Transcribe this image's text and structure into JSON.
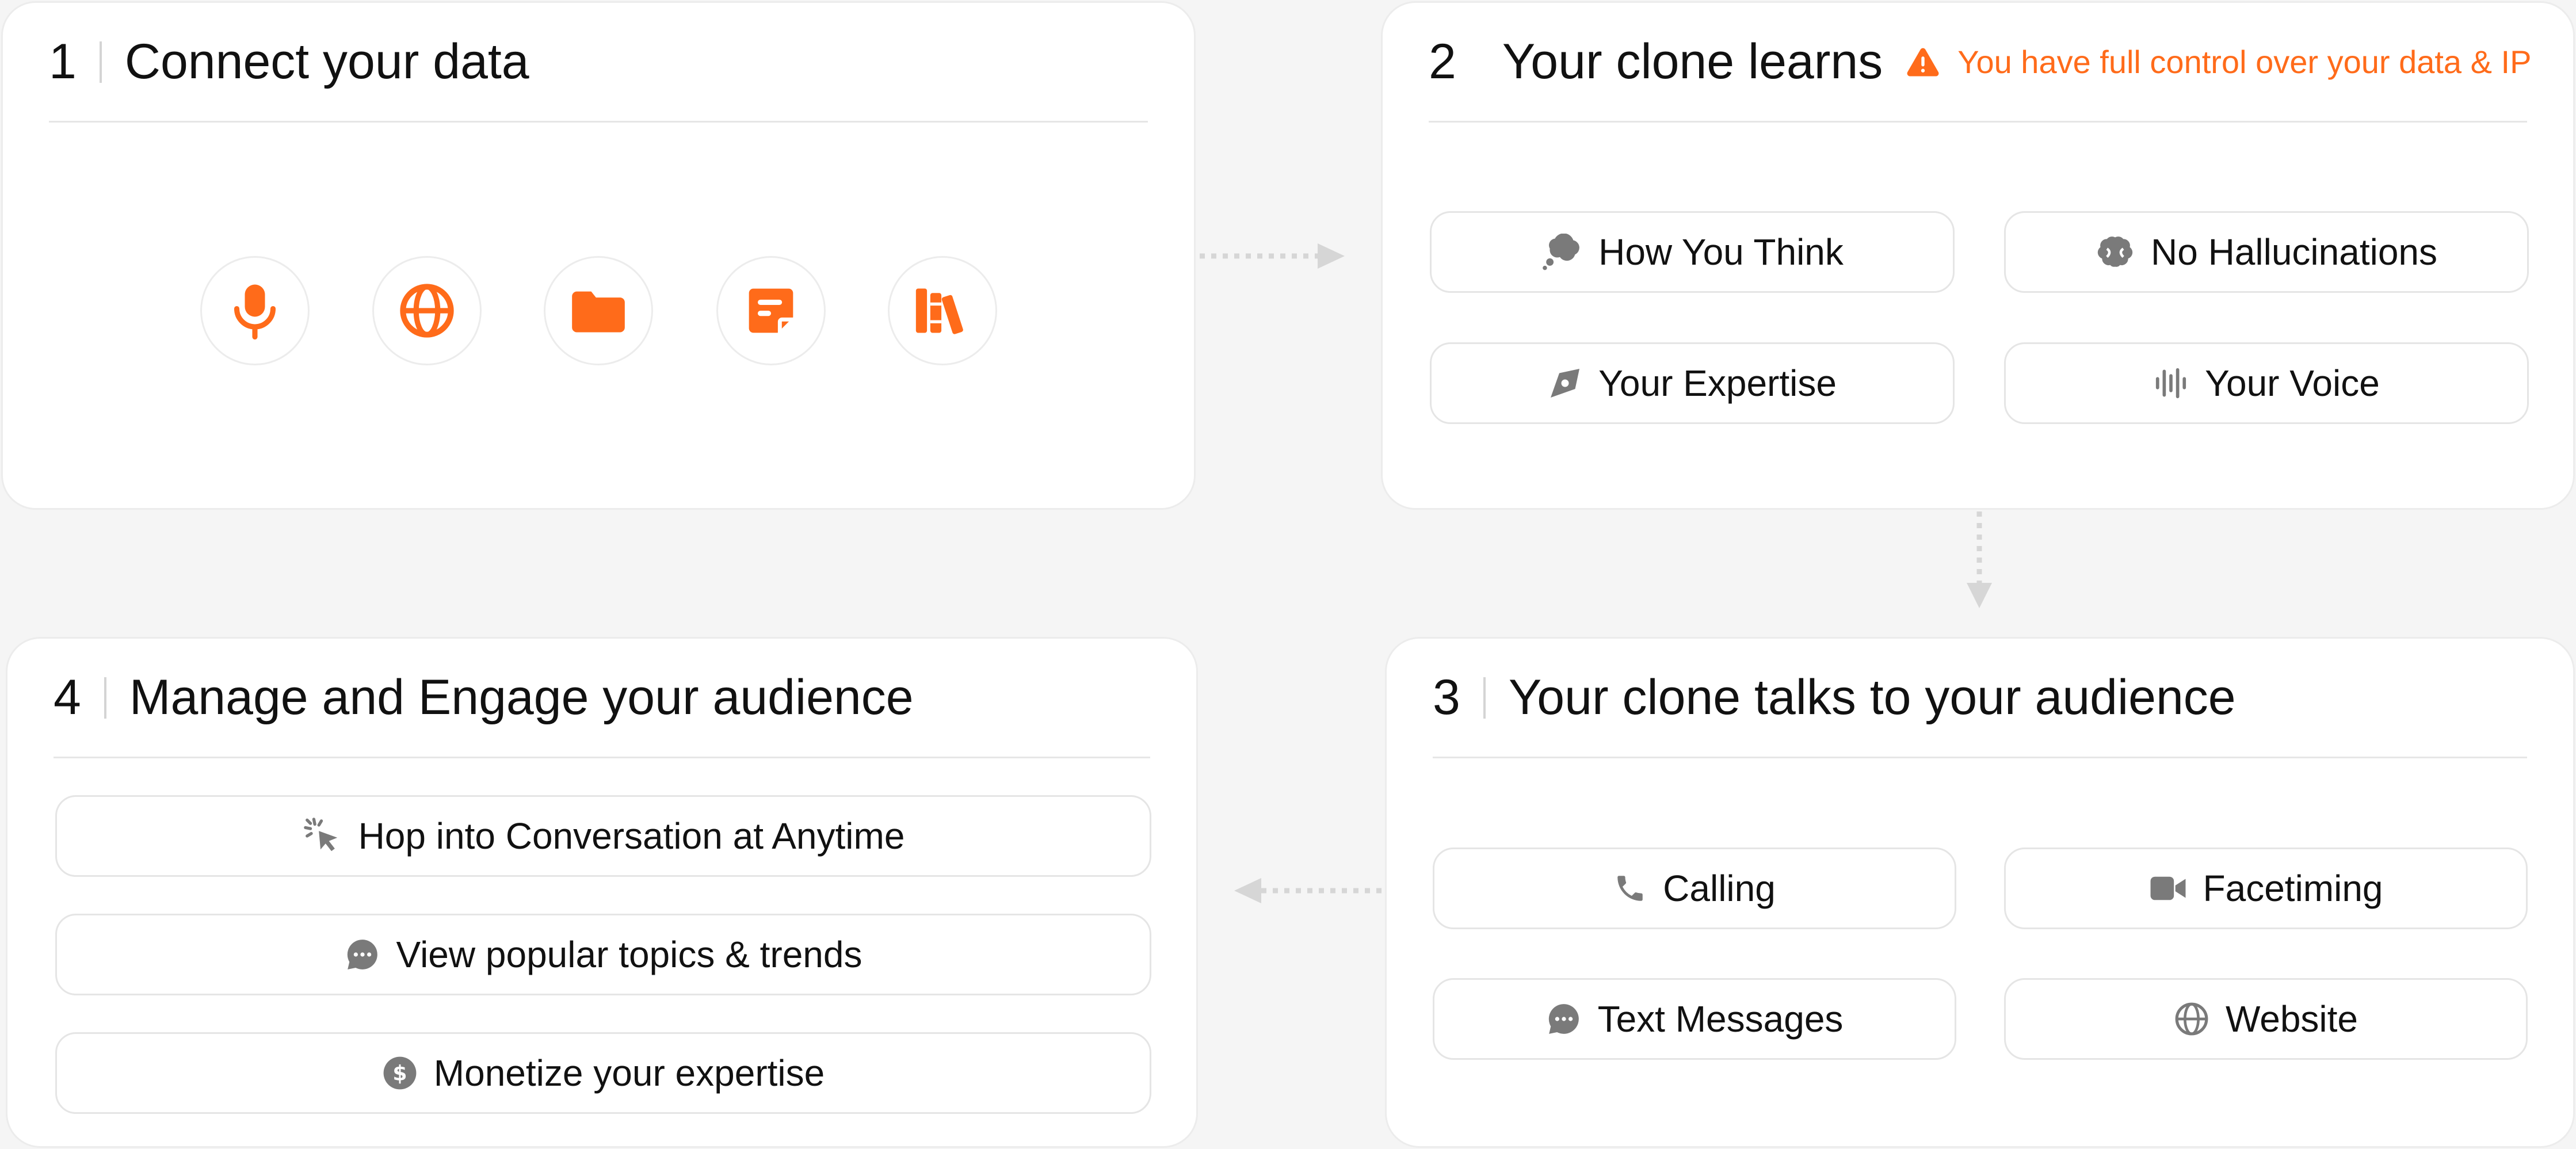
{
  "steps": {
    "connect": {
      "number": "1",
      "title": "Connect your data",
      "sources": [
        "microphone-icon",
        "globe-icon",
        "folder-icon",
        "note-icon",
        "library-icon"
      ]
    },
    "learns": {
      "number": "2",
      "title": "Your clone learns",
      "notice": "You have full control over your data & IP",
      "items": [
        "How You Think",
        "No Hallucinations",
        "Your Expertise",
        "Your Voice"
      ]
    },
    "talks": {
      "number": "3",
      "title": "Your clone talks to your audience",
      "items": [
        "Calling",
        "Facetiming",
        "Text Messages",
        "Website"
      ]
    },
    "manage": {
      "number": "4",
      "title": "Manage and Engage your audience",
      "items": [
        "Hop into Conversation at Anytime",
        "View popular topics & trends",
        "Monetize your expertise"
      ]
    }
  },
  "colors": {
    "accent": "#ff6b1a",
    "icon_gray": "#7a7a7a",
    "connector": "#d6d6d6"
  }
}
